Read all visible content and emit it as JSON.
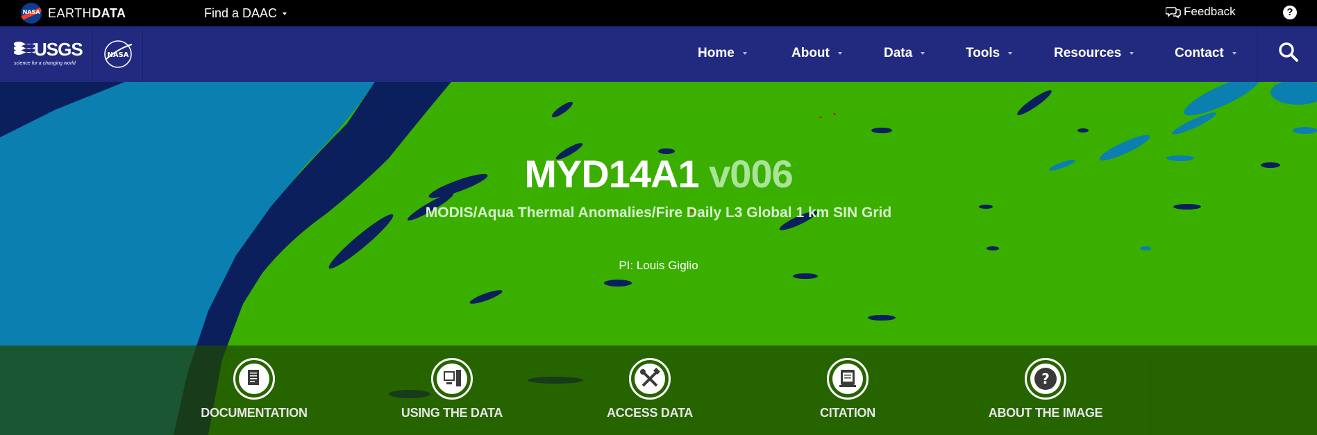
{
  "topbar": {
    "brand_light": "EARTH",
    "brand_bold": "DATA",
    "find_daac": "Find a DAAC",
    "feedback": "Feedback",
    "help": "?"
  },
  "navbar": {
    "usgs_word": "USGS",
    "usgs_tagline": "science for a changing world",
    "links": [
      {
        "label": "Home"
      },
      {
        "label": "About"
      },
      {
        "label": "Data"
      },
      {
        "label": "Tools"
      },
      {
        "label": "Resources"
      },
      {
        "label": "Contact"
      }
    ]
  },
  "hero": {
    "product": "MYD14A1",
    "version": "v006",
    "subtitle": "MODIS/Aqua Thermal Anomalies/Fire Daily L3 Global 1 km SIN Grid",
    "pi": "PI: Louis Giglio",
    "actions": [
      {
        "label": "DOCUMENTATION",
        "icon": "document-icon"
      },
      {
        "label": "USING THE DATA",
        "icon": "computer-icon"
      },
      {
        "label": "ACCESS DATA",
        "icon": "tools-icon"
      },
      {
        "label": "CITATION",
        "icon": "citation-icon"
      },
      {
        "label": "ABOUT THE IMAGE",
        "icon": "question-icon"
      }
    ]
  },
  "colors": {
    "topbar": "#000000",
    "navbar": "#222a80",
    "land_green": "#3aaf00",
    "ocean_dark": "#0a1f5c",
    "ocean_light": "#0b7fb0"
  }
}
